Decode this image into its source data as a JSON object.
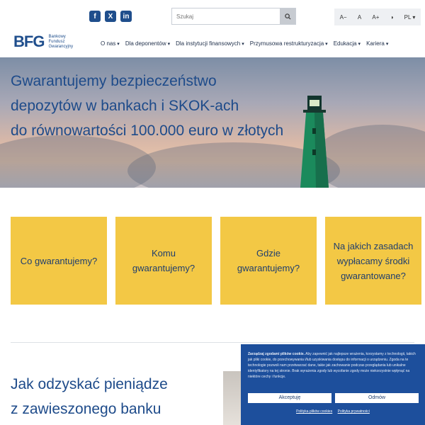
{
  "social": [
    "f",
    "X",
    "in"
  ],
  "search": {
    "placeholder": "Szukaj"
  },
  "accessibility": [
    "A−",
    "A",
    "A+",
    "◑",
    "PL ▾"
  ],
  "logo": {
    "mark": "BFG",
    "line1": "Bankowy",
    "line2": "Fundusz",
    "line3": "Gwarancyjny"
  },
  "nav": [
    "O nas",
    "Dla deponentów",
    "Dla instytucji finansowych",
    "Przymusowa restrukturyzacja",
    "Edukacja",
    "Kariera"
  ],
  "hero": {
    "line1": "Gwarantujemy bezpieczeństwo",
    "line2": "depozytów w bankach i SKOK-ach",
    "line3": "do równowartości 100.000 euro w złotych"
  },
  "cards": [
    "Co gwarantujemy?",
    "Komu gwarantujemy?",
    "Gdzie gwarantujemy?",
    "Na jakich zasadach wypłacamy środki gwarantowane?"
  ],
  "section2": {
    "line1": "Jak odzyskać pieniądze",
    "line2": "z zawieszonego banku"
  },
  "cookie": {
    "text_bold": "Zarządzaj zgodami plików cookie.",
    "text": " Aby zapewnić jak najlepsze wrażenia, korzystamy z technologii, takich jak pliki cookie, do przechowywania i/lub uzyskiwania dostępu do informacji o urządzeniu. Zgoda na te technologie pozwoli nam przetwarzać dane, takie jak zachowanie podczas przeglądania lub unikalne identyfikatory na tej stronie. Brak wyrażenia zgody lub wycofanie zgody może niekorzystnie wpłynąć na niektóre cechy i funkcje.",
    "accept": "Akceptuję",
    "reject": "Odmów",
    "link1": "Polityka plików cookies",
    "link2": "Polityka prywatności"
  }
}
